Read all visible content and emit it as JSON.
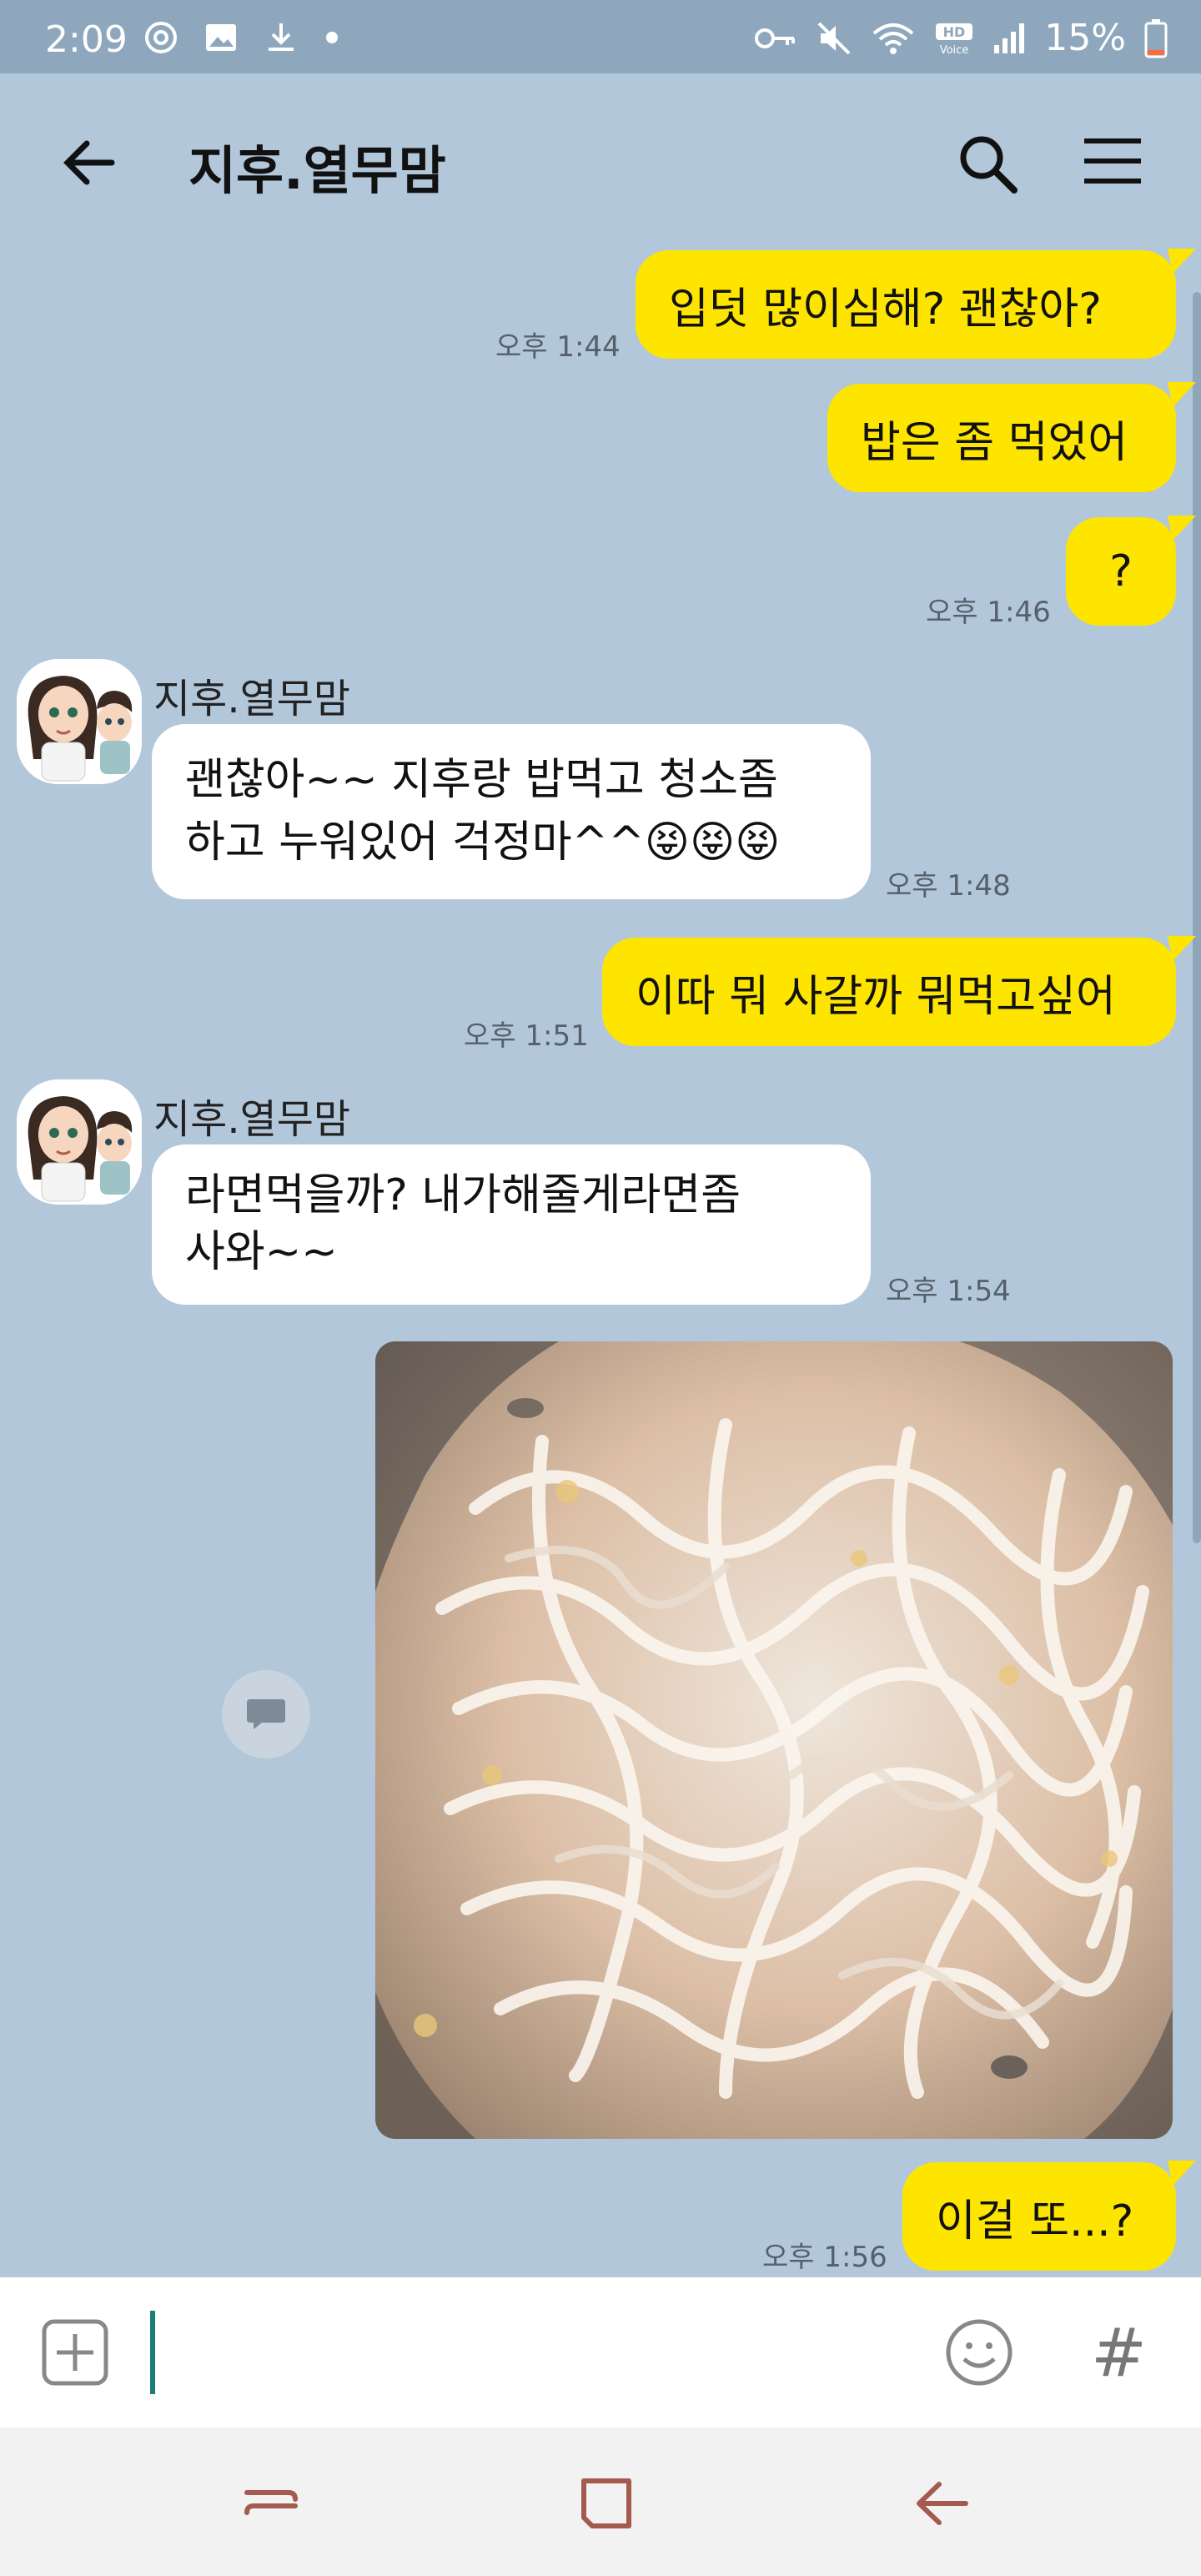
{
  "status_bar": {
    "time": "2:09",
    "battery": "15%",
    "hd_voice": "HD Voice",
    "icons_left": [
      "sync-icon",
      "image-icon",
      "download-icon",
      "dot-icon"
    ],
    "icons_right": [
      "key-icon",
      "mute-icon",
      "wifi-icon",
      "hd-voice-icon",
      "signal-icon",
      "battery-icon"
    ],
    "battery_color": "#ff6a3d"
  },
  "header": {
    "title": "지후.열무맘",
    "icons": [
      "back-arrow-icon",
      "search-icon",
      "hamburger-menu-icon"
    ]
  },
  "messages": [
    {
      "from": "me",
      "text": "입덧 많이심해?  괜찮아?",
      "time": "오후 1:44"
    },
    {
      "from": "me",
      "text": "밥은 좀 먹었어",
      "time": ""
    },
    {
      "from": "me",
      "text": "?",
      "time": "오후 1:46"
    },
    {
      "from": "other",
      "sender": "지후.열무맘",
      "text_line1": "괜찮아~~ 지후랑 밥먹고 청소좀",
      "text_line2": "하고 누워있어 걱정마^^",
      "emoji": "😝😝😝",
      "time": "오후 1:48"
    },
    {
      "from": "me",
      "text": "이따 뭐 사갈까 뭐먹고싶어",
      "time": "오후 1:51"
    },
    {
      "from": "other",
      "sender": "지후.열무맘",
      "text_line1": "라면먹을까? 내가해줄게라면좀",
      "text_line2": "사와~~",
      "time": "오후 1:54"
    },
    {
      "from": "me",
      "type": "photo",
      "image": "noodles-photo"
    },
    {
      "from": "me",
      "text": "이걸 또...?",
      "time": "오후 1:56"
    }
  ],
  "input_bar": {
    "icons": [
      "plus-icon",
      "emoji-icon",
      "hashtag-icon"
    ],
    "hash_label": "#",
    "value": ""
  },
  "nav_bar": {
    "icons": [
      "recent-apps-icon",
      "home-icon",
      "back-icon"
    ]
  },
  "colors": {
    "background": "#b2c7da",
    "my_bubble": "#fee500",
    "other_bubble": "#ffffff"
  }
}
